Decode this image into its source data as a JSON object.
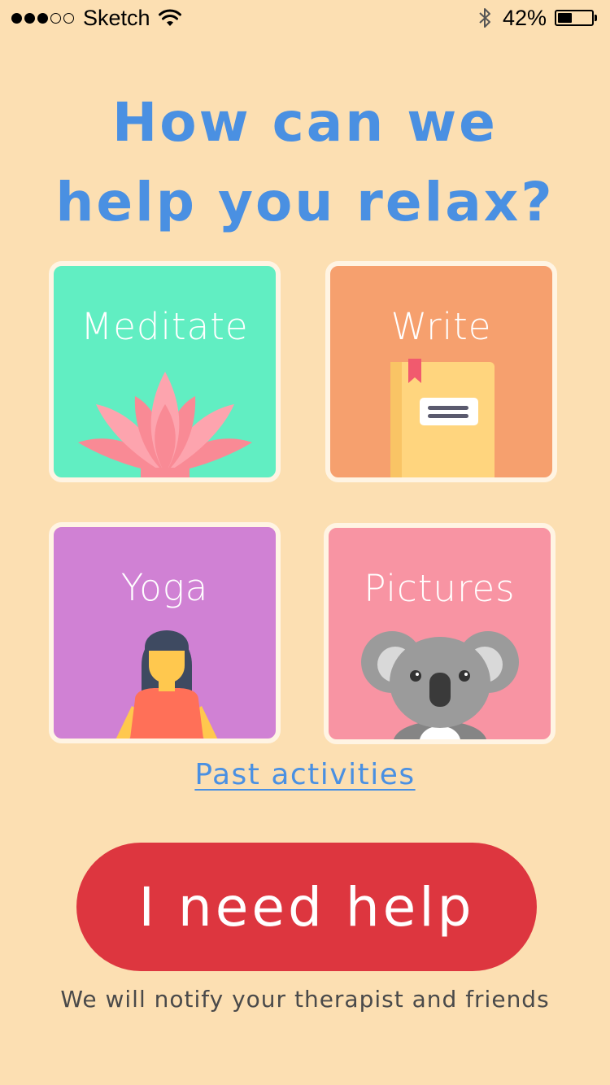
{
  "status_bar": {
    "carrier": "Sketch",
    "battery_percent": "42%",
    "battery_level": 0.42,
    "signal_strength": 3,
    "signal_max": 5,
    "icons": [
      "signal-dots-icon",
      "wifi-icon",
      "bluetooth-icon",
      "battery-icon"
    ]
  },
  "header": {
    "title_line1": "How can we",
    "title_line2": "help you relax?"
  },
  "activities": [
    {
      "label": "Meditate",
      "icon": "lotus-icon",
      "color": "#61EEC2"
    },
    {
      "label": "Write",
      "icon": "notebook-icon",
      "color": "#F6A06E"
    },
    {
      "label": "Yoga",
      "icon": "yoga-woman-icon",
      "color": "#D081D4"
    },
    {
      "label": "Pictures",
      "icon": "koala-icon",
      "color": "#F894A3"
    }
  ],
  "past_activities_link": "Past activities",
  "help_button": {
    "label": "I need help",
    "note": "We will notify your therapist and friends"
  },
  "colors": {
    "background": "#FCDFB2",
    "accent_blue": "#4A90E2",
    "help_red": "#DD363F",
    "card_border": "#FFF4E3"
  }
}
